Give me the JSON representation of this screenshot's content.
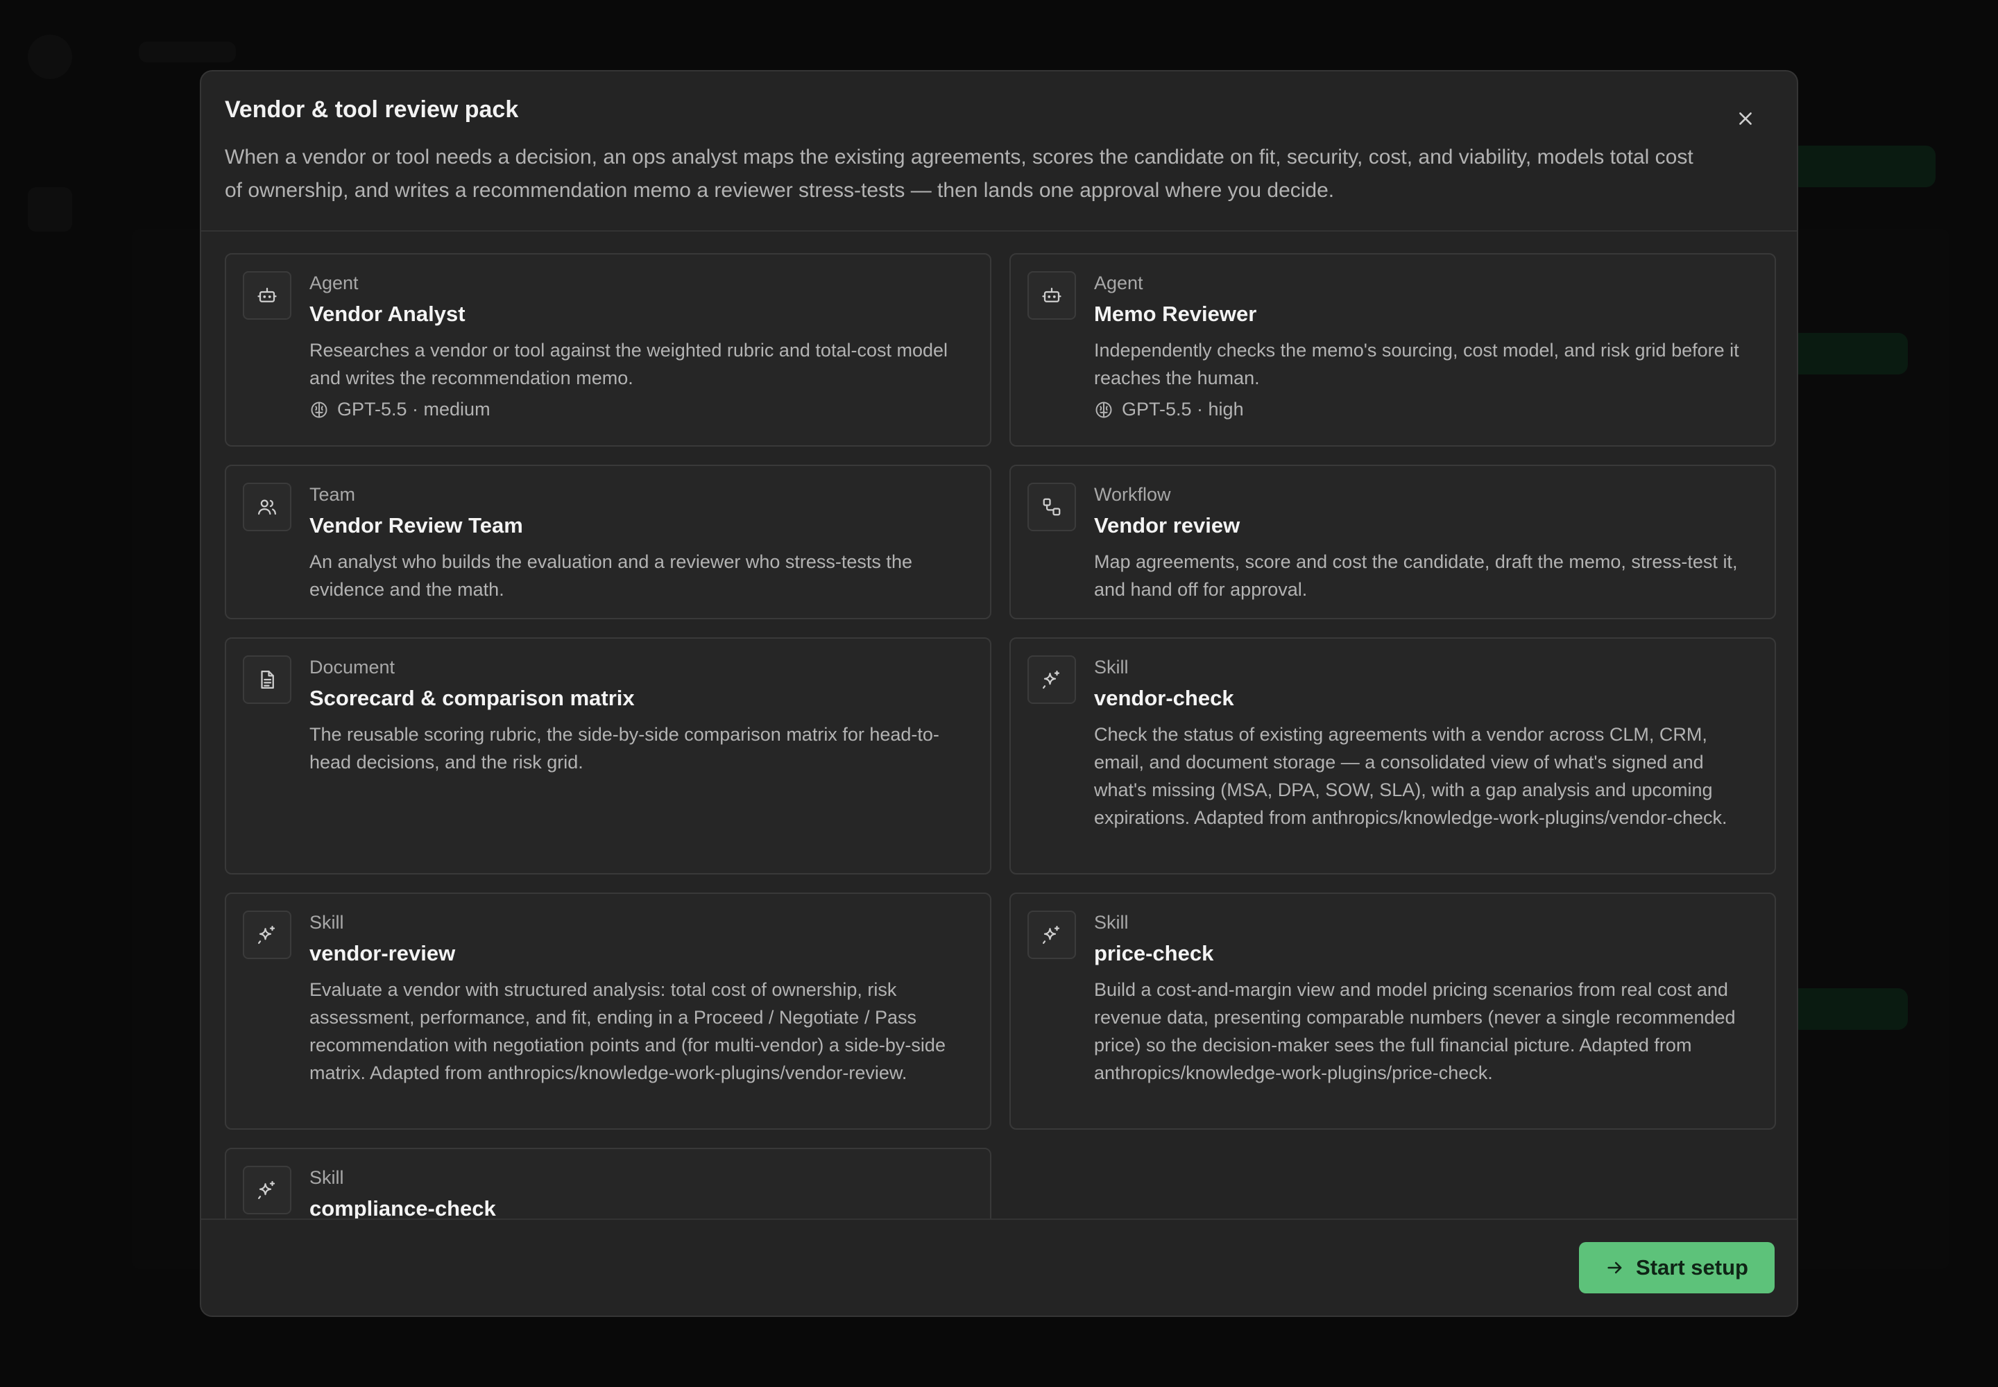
{
  "modal": {
    "title": "Vendor & tool review pack",
    "description": "When a vendor or tool needs a decision, an ops analyst maps the existing agreements, scores the candidate on fit, security, cost, and viability, models total cost of ownership, and writes a recommendation memo a reviewer stress-tests — then lands one approval where you decide.",
    "close_icon": "close-icon"
  },
  "cards": [
    {
      "kind": "Agent",
      "name": "Vendor Analyst",
      "description": "Researches a vendor or tool against the weighted rubric and total-cost model and writes the recommendation memo.",
      "model": "GPT-5.5 · medium",
      "icon": "bot-icon"
    },
    {
      "kind": "Agent",
      "name": "Memo Reviewer",
      "description": "Independently checks the memo's sourcing, cost model, and risk grid before it reaches the human.",
      "model": "GPT-5.5 · high",
      "icon": "bot-icon"
    },
    {
      "kind": "Team",
      "name": "Vendor Review Team",
      "description": "An analyst who builds the evaluation and a reviewer who stress-tests the evidence and the math.",
      "icon": "users-icon"
    },
    {
      "kind": "Workflow",
      "name": "Vendor review",
      "description": "Map agreements, score and cost the candidate, draft the memo, stress-test it, and hand off for approval.",
      "icon": "workflow-icon"
    },
    {
      "kind": "Document",
      "name": "Scorecard & comparison matrix",
      "description": "The reusable scoring rubric, the side-by-side comparison matrix for head-to-head decisions, and the risk grid.",
      "icon": "document-icon"
    },
    {
      "kind": "Skill",
      "name": "vendor-check",
      "description": "Check the status of existing agreements with a vendor across CLM, CRM, email, and document storage — a consolidated view of what's signed and what's missing (MSA, DPA, SOW, SLA), with a gap analysis and upcoming expirations. Adapted from anthropics/knowledge-work-plugins/vendor-check.",
      "icon": "sparkle-icon"
    },
    {
      "kind": "Skill",
      "name": "vendor-review",
      "description": "Evaluate a vendor with structured analysis: total cost of ownership, risk assessment, performance, and fit, ending in a Proceed / Negotiate / Pass recommendation with negotiation points and (for multi-vendor) a side-by-side matrix. Adapted from anthropics/knowledge-work-plugins/vendor-review.",
      "icon": "sparkle-icon"
    },
    {
      "kind": "Skill",
      "name": "price-check",
      "description": "Build a cost-and-margin view and model pricing scenarios from real cost and revenue data, presenting comparable numbers (never a single recommended price) so the decision-maker sees the full financial picture. Adapted from anthropics/knowledge-work-plugins/price-check.",
      "icon": "sparkle-icon"
    },
    {
      "kind": "Skill",
      "name": "compliance-check",
      "icon": "sparkle-icon"
    }
  ],
  "footer": {
    "start_label": "Start setup",
    "start_icon": "arrow-right-icon",
    "accent_color": "#5dc27a"
  }
}
